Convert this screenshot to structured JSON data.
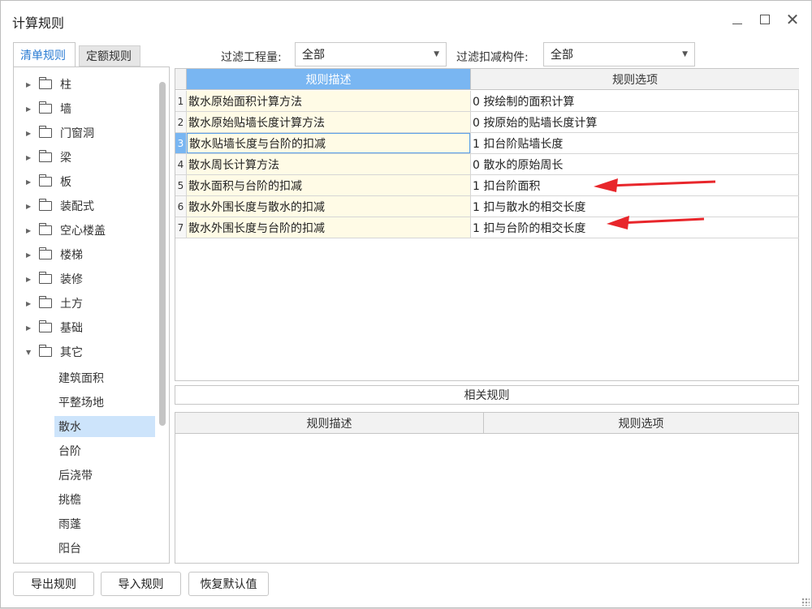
{
  "window": {
    "title": "计算规则"
  },
  "tabs": [
    {
      "label": "清单规则",
      "active": true
    },
    {
      "label": "定额规则",
      "active": false
    }
  ],
  "filters": {
    "quantity_label": "过滤工程量:",
    "quantity_value": "全部",
    "deduct_label": "过滤扣减构件:",
    "deduct_value": "全部"
  },
  "tree": {
    "folders": [
      "柱",
      "墙",
      "门窗洞",
      "梁",
      "板",
      "装配式",
      "空心楼盖",
      "楼梯",
      "装修",
      "土方",
      "基础",
      "其它"
    ],
    "expanded": "其它",
    "leaves": [
      "建筑面积",
      "平整场地",
      "散水",
      "台阶",
      "后浇带",
      "挑檐",
      "雨蓬",
      "阳台"
    ],
    "selected_leaf": "散水"
  },
  "grid": {
    "headers": {
      "desc": "规则描述",
      "opt": "规则选项"
    },
    "current_row": 3,
    "rows": [
      {
        "num": "1",
        "desc": "散水原始面积计算方法",
        "opt": "0 按绘制的面积计算"
      },
      {
        "num": "2",
        "desc": "散水原始贴墙长度计算方法",
        "opt": "0 按原始的贴墙长度计算"
      },
      {
        "num": "3",
        "desc": "散水贴墙长度与台阶的扣减",
        "opt": "1 扣台阶贴墙长度"
      },
      {
        "num": "4",
        "desc": "散水周长计算方法",
        "opt": "0 散水的原始周长"
      },
      {
        "num": "5",
        "desc": "散水面积与台阶的扣减",
        "opt": "1 扣台阶面积"
      },
      {
        "num": "6",
        "desc": "散水外围长度与散水的扣减",
        "opt": "1 扣与散水的相交长度"
      },
      {
        "num": "7",
        "desc": "散水外围长度与台阶的扣减",
        "opt": "1 扣与台阶的相交长度"
      }
    ]
  },
  "related": {
    "title": "相关规则",
    "headers": {
      "desc": "规则描述",
      "opt": "规则选项"
    }
  },
  "buttons": {
    "export": "导出规则",
    "import": "导入规则",
    "restore": "恢复默认值"
  },
  "colors": {
    "accent": "#79b6f2",
    "selected_row_bg": "#cde4fb",
    "desc_cell_bg": "#fffbe6",
    "annotation_arrow": "#e8262b"
  }
}
